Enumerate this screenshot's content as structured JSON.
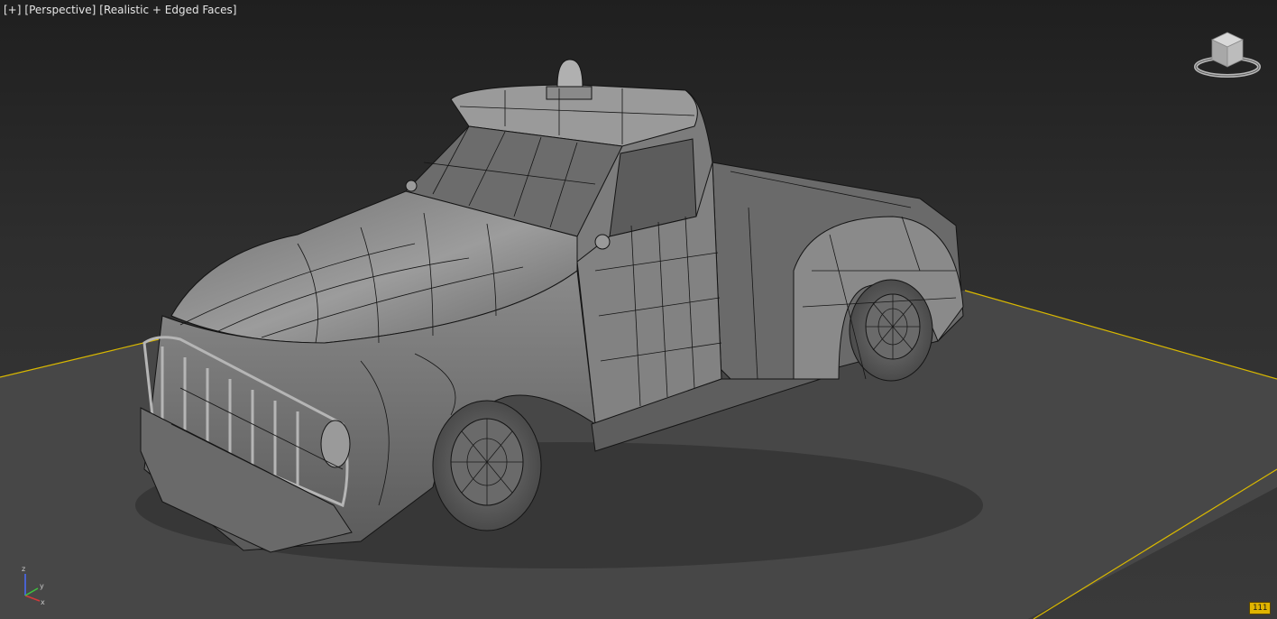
{
  "viewport": {
    "labels": {
      "menu": "[+]",
      "view": "[Perspective]",
      "shading": "[Realistic + Edged Faces]"
    },
    "axis": {
      "x": "x",
      "y": "y",
      "z": "z"
    },
    "badge": "111",
    "colors": {
      "grid_edge": "#d9b800",
      "ground": "#4a4a4a",
      "model_fill": "#6e6e6e",
      "wire": "#141414",
      "axis_x": "#d23a3a",
      "axis_y": "#3ec43e",
      "axis_z": "#4a6bff"
    }
  }
}
